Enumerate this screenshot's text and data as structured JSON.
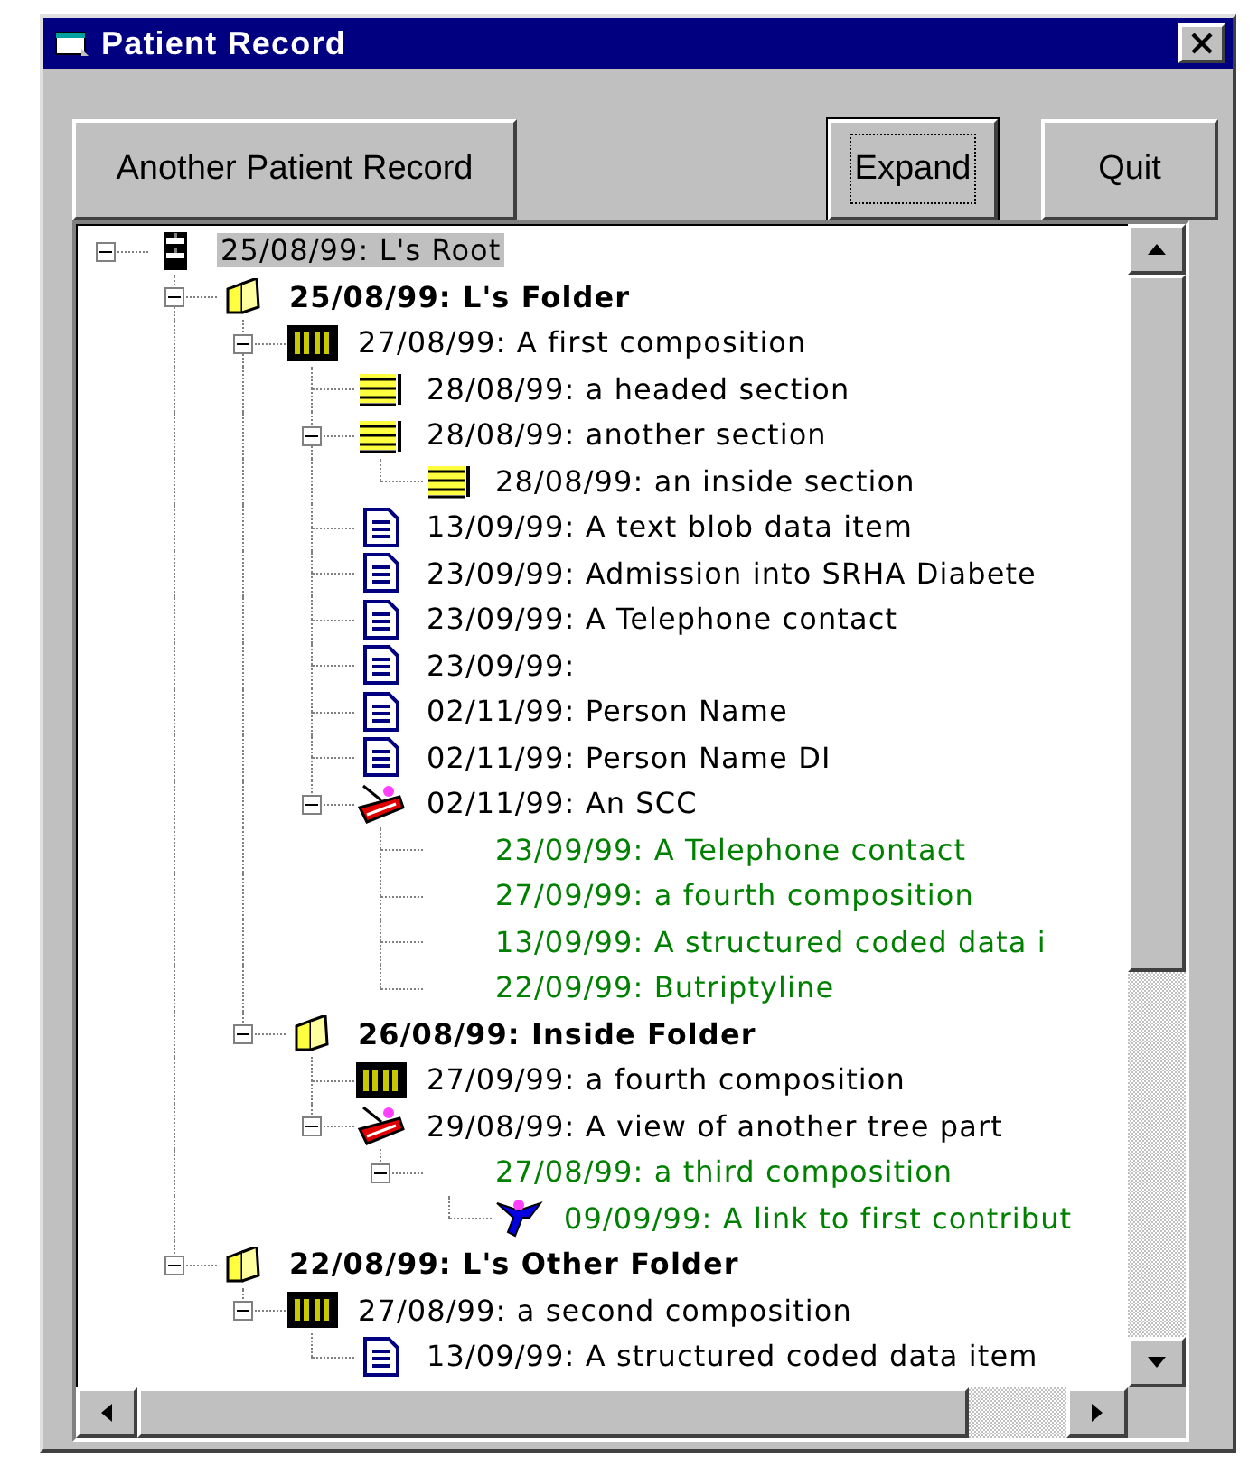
{
  "window": {
    "title": "Patient Record"
  },
  "buttons": [
    {
      "label": "Another Patient Record",
      "focused": false
    },
    {
      "label": "Expand",
      "focused": true
    },
    {
      "label": "Quit",
      "focused": false
    }
  ],
  "tree": [
    {
      "kind": "root",
      "label": "25/08/99: L's Root",
      "selected": true,
      "linked": false,
      "expanded": true,
      "children": [
        {
          "kind": "folder",
          "label": "25/08/99: L's Folder",
          "selected": false,
          "linked": false,
          "expanded": true,
          "children": [
            {
              "kind": "composition",
              "label": "27/08/99: A first composition",
              "selected": false,
              "linked": false,
              "expanded": true,
              "children": [
                {
                  "kind": "section",
                  "label": "28/08/99: a headed section",
                  "selected": false,
                  "linked": false
                },
                {
                  "kind": "section",
                  "label": "28/08/99: another section",
                  "selected": false,
                  "linked": false,
                  "expanded": true,
                  "children": [
                    {
                      "kind": "section",
                      "label": "28/08/99: an inside section",
                      "selected": false,
                      "linked": false
                    }
                  ]
                },
                {
                  "kind": "entry",
                  "label": "13/09/99: A text blob data item",
                  "selected": false,
                  "linked": false
                },
                {
                  "kind": "entry",
                  "label": "23/09/99: Admission into SRHA Diabete",
                  "selected": false,
                  "linked": false
                },
                {
                  "kind": "entry",
                  "label": "23/09/99: A Telephone contact",
                  "selected": false,
                  "linked": false
                },
                {
                  "kind": "entry",
                  "label": "23/09/99:",
                  "selected": false,
                  "linked": false
                },
                {
                  "kind": "entry",
                  "label": "02/11/99: Person Name",
                  "selected": false,
                  "linked": false
                },
                {
                  "kind": "entry",
                  "label": "02/11/99: Person Name DI",
                  "selected": false,
                  "linked": false
                },
                {
                  "kind": "scc",
                  "label": "02/11/99: An SCC",
                  "selected": false,
                  "linked": false,
                  "expanded": true,
                  "children": [
                    {
                      "kind": "blank",
                      "label": "23/09/99: A Telephone contact",
                      "selected": false,
                      "linked": true
                    },
                    {
                      "kind": "blank",
                      "label": "27/09/99: a fourth composition",
                      "selected": false,
                      "linked": true
                    },
                    {
                      "kind": "blank",
                      "label": "13/09/99: A structured coded data i",
                      "selected": false,
                      "linked": true
                    },
                    {
                      "kind": "blank",
                      "label": "22/09/99: Butriptyline",
                      "selected": false,
                      "linked": true
                    }
                  ]
                }
              ]
            },
            {
              "kind": "folder",
              "label": "26/08/99: Inside Folder",
              "selected": false,
              "linked": false,
              "expanded": true,
              "children": [
                {
                  "kind": "composition",
                  "label": "27/09/99: a fourth composition",
                  "selected": false,
                  "linked": false
                },
                {
                  "kind": "scc",
                  "label": "29/08/99: A view of another tree part",
                  "selected": false,
                  "linked": false,
                  "expanded": true,
                  "children": [
                    {
                      "kind": "blank",
                      "label": "27/08/99: a third composition",
                      "selected": false,
                      "linked": true,
                      "expanded": true,
                      "children": [
                        {
                          "kind": "link",
                          "label": "09/09/99: A link to first contribut",
                          "selected": false,
                          "linked": true
                        }
                      ]
                    }
                  ]
                }
              ]
            }
          ]
        },
        {
          "kind": "folder",
          "label": "22/08/99: L's Other Folder",
          "selected": false,
          "linked": false,
          "expanded": true,
          "children": [
            {
              "kind": "composition",
              "label": "27/08/99: a second composition",
              "selected": false,
              "linked": false,
              "expanded": true,
              "children": [
                {
                  "kind": "entry",
                  "label": "13/09/99: A structured coded data item",
                  "selected": false,
                  "linked": false
                }
              ]
            }
          ]
        }
      ]
    }
  ]
}
